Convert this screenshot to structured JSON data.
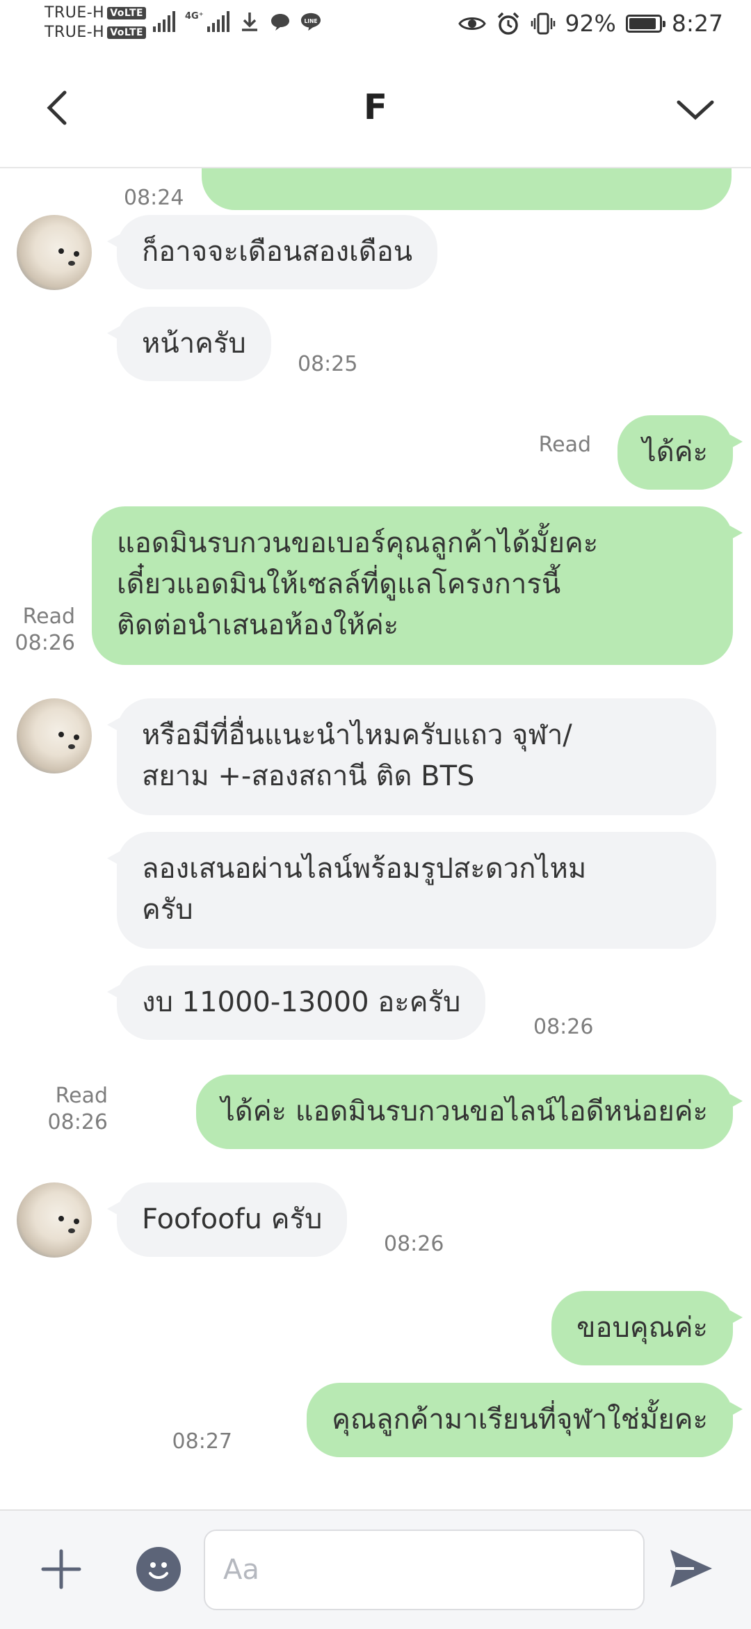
{
  "status_bar": {
    "carrier_1": "TRUE-H",
    "carrier_2": "TRUE-H",
    "volte_badge": "VoLTE",
    "network_type": "4G⁺",
    "battery": "92%",
    "time": "8:27"
  },
  "header": {
    "title": "F"
  },
  "messages": [
    {
      "dir": "out",
      "text": "",
      "time": "08:24",
      "read": ""
    },
    {
      "dir": "in",
      "text": "ก็อาจจะเดือนสองเดือน",
      "time": ""
    },
    {
      "dir": "in",
      "text": "หน้าครับ",
      "time": "08:25"
    },
    {
      "dir": "out",
      "text": "ได้ค่ะ",
      "time": "",
      "read": "Read"
    },
    {
      "dir": "out",
      "text": "แอดมินรบกวนขอเบอร์คุณลูกค้าได้มั้ยคะ\nเดี๋ยวแอดมินให้เซลล์ที่ดูแลโครงการนี้\nติดต่อนำเสนอห้องให้ค่ะ",
      "time": "08:26",
      "read": "Read"
    },
    {
      "dir": "in",
      "text": "หรือมีที่อื่นแนะนำไหมครับแถว จุฬา/\nสยาม +-สองสถานี ติด BTS",
      "time": ""
    },
    {
      "dir": "in",
      "text": "ลองเสนอผ่านไลน์พร้อมรูปสะดวกไหม\nครับ",
      "time": ""
    },
    {
      "dir": "in",
      "text": "งบ 11000-13000 อะครับ",
      "time": "08:26"
    },
    {
      "dir": "out",
      "text": "ได้ค่ะ แอดมินรบกวนขอไลน์ไอดีหน่อยค่ะ",
      "time": "08:26",
      "read": "Read"
    },
    {
      "dir": "in",
      "text": "Foofoofu ครับ",
      "time": "08:26"
    },
    {
      "dir": "out",
      "text": "ขอบคุณค่ะ",
      "time": "",
      "read": ""
    },
    {
      "dir": "out",
      "text": "คุณลูกค้ามาเรียนที่จุฬาใช่มั้ยคะ",
      "time": "08:27",
      "read": ""
    }
  ],
  "input": {
    "placeholder": "Aa"
  },
  "colors": {
    "incoming_bubble": "#f2f3f5",
    "outgoing_bubble": "#b8e9b3",
    "icon": "#5c6478"
  },
  "icons": {
    "back": "chevron-left-icon",
    "collapse": "chevron-down-icon",
    "plus": "plus-icon",
    "emoji": "smiley-icon",
    "send": "send-icon"
  }
}
